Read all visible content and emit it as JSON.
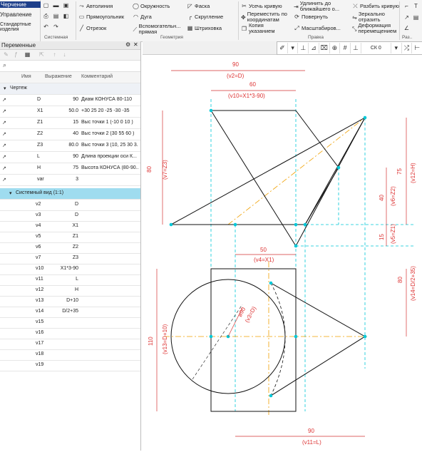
{
  "ribbon": {
    "left_items": [
      "Черчение",
      "Управление",
      "Стандартные изделия"
    ],
    "groups": [
      "Системная",
      "Геометрия",
      "Правка",
      "Раз.."
    ],
    "geometry_buttons": [
      {
        "label": "Автолиния",
        "icon": "autoline-icon"
      },
      {
        "label": "Окружность",
        "icon": "circle-icon"
      },
      {
        "label": "Фаска",
        "icon": "chamfer-icon"
      },
      {
        "label": "Прямоугольник",
        "icon": "rectangle-icon"
      },
      {
        "label": "Дуга",
        "icon": "arc-icon"
      },
      {
        "label": "Скругление",
        "icon": "fillet-icon"
      },
      {
        "label": "Отрезок",
        "icon": "segment-icon"
      },
      {
        "label": "Вспомогательн... прямая",
        "icon": "aux-line-icon"
      },
      {
        "label": "Штриховка",
        "icon": "hatch-icon"
      }
    ],
    "edit_buttons": [
      {
        "label": "Усечь кривую",
        "icon": "trim-icon"
      },
      {
        "label": "Удлинить до ближайшего о...",
        "icon": "extend-icon"
      },
      {
        "label": "Разбить кривую",
        "icon": "split-icon"
      },
      {
        "label": "Переместить по координатам",
        "icon": "move-icon"
      },
      {
        "label": "Повернуть",
        "icon": "rotate-icon"
      },
      {
        "label": "Зеркально отразить",
        "icon": "mirror-icon"
      },
      {
        "label": "Копия указанием",
        "icon": "copy-icon"
      },
      {
        "label": "Масштабиров...",
        "icon": "scale-icon"
      },
      {
        "label": "Деформация перемещением",
        "icon": "deform-icon"
      }
    ]
  },
  "panel": {
    "title": "Переменные",
    "search_placeholder": "",
    "columns": {
      "name": "Имя",
      "expr": "Выражение",
      "comment": "Комментарий"
    },
    "section_drawing": "Чертеж",
    "section_view": "Системный вид (1:1)",
    "drawing_vars": [
      {
        "name": "D",
        "expr": "90",
        "comment": "Диам КОНУСА 80-110"
      },
      {
        "name": "X1",
        "expr": "50.0",
        "comment": "+30 25 20 -25 -30 -35"
      },
      {
        "name": "Z1",
        "expr": "15",
        "comment": "Выс точки 1 (-10 0 10 )"
      },
      {
        "name": "Z2",
        "expr": "40",
        "comment": "Выс точки 2 (30 55 60 )"
      },
      {
        "name": "Z3",
        "expr": "80.0",
        "comment": "Выс точки 3 (10, 25 30 3..."
      },
      {
        "name": "L",
        "expr": "90",
        "comment": "Длина проекции оси К..."
      },
      {
        "name": "H",
        "expr": "75",
        "comment": "Высота КОНУСА (80-90..."
      },
      {
        "name": "var",
        "expr": "3",
        "comment": ""
      }
    ],
    "view_vars": [
      {
        "name": "v2",
        "expr": "D"
      },
      {
        "name": "v3",
        "expr": "D"
      },
      {
        "name": "v4",
        "expr": "X1"
      },
      {
        "name": "v5",
        "expr": "Z1"
      },
      {
        "name": "v6",
        "expr": "Z2"
      },
      {
        "name": "v7",
        "expr": "Z3"
      },
      {
        "name": "v10",
        "expr": "X1*3-90"
      },
      {
        "name": "v11",
        "expr": "L"
      },
      {
        "name": "v12",
        "expr": "H"
      },
      {
        "name": "v13",
        "expr": "D+10"
      },
      {
        "name": "v14",
        "expr": "D/2+35"
      },
      {
        "name": "v15",
        "expr": ""
      },
      {
        "name": "v16",
        "expr": ""
      },
      {
        "name": "v17",
        "expr": ""
      },
      {
        "name": "v18",
        "expr": ""
      },
      {
        "name": "v19",
        "expr": ""
      }
    ]
  },
  "view_toolbar": {
    "coord_system": "СК 0"
  },
  "dimensions": {
    "top_width": "90",
    "top_width_var": "(v2=D)",
    "top_inner": "60",
    "top_inner_var": "(v10=X1*3-90)",
    "left_h": "80",
    "left_h_var": "(v7=Z3)",
    "right_75": "75",
    "right_75_var": "(v12=H)",
    "right_40": "40",
    "right_40_var": "(v6=Z2)",
    "right_15": "15",
    "right_15_var": "(v5=Z1)",
    "bottom_50": "50",
    "bottom_50_var": "(v4=X1)",
    "phi": "ø90",
    "phi_var": "(v3=D)",
    "left_110": "110",
    "left_110_var": "(v13=D+10)",
    "right_80": "80",
    "right_80_var": "(v14=D/2+35)",
    "bottom_90": "90",
    "bottom_90_var": "(v11=L)"
  },
  "colors": {
    "accent": "#00c8d8",
    "dimension": "#d33333",
    "axis": "#f0a000",
    "section": "#9fdcef"
  }
}
